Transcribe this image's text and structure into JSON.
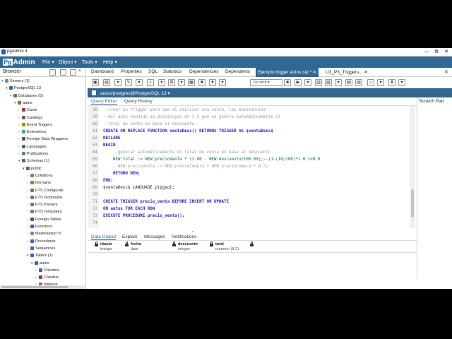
{
  "window": {
    "title": "pgAdmin 4",
    "controls": [
      "—",
      "⧉",
      "✕"
    ]
  },
  "menubar": {
    "logo_pg": "Pg",
    "logo_text": "Admin",
    "items": [
      "File",
      "Object",
      "Tools",
      "Help"
    ]
  },
  "browser": {
    "title": "Browser",
    "tree": [
      {
        "label": "Servers (1)",
        "arrow": "▾",
        "color": "#6b8fb4"
      },
      {
        "label": "PostgreSQL 13",
        "arrow": "▾",
        "color": "#336791"
      },
      {
        "label": "Databases (5)",
        "arrow": "▾",
        "color": "#8a6d3b"
      },
      {
        "label": "autos",
        "arrow": "▾",
        "color": "#8a6d3b"
      },
      {
        "label": "Casts",
        "arrow": "›",
        "color": "#a33"
      },
      {
        "label": "Catalogs",
        "arrow": "›",
        "color": "#666"
      },
      {
        "label": "Event Triggers",
        "arrow": "›",
        "color": "#b58900"
      },
      {
        "label": "Extensions",
        "arrow": "›",
        "color": "#4a7"
      },
      {
        "label": "Foreign Data Wrappers",
        "arrow": "›",
        "color": "#557"
      },
      {
        "label": "Languages",
        "arrow": "›",
        "color": "#666"
      },
      {
        "label": "Publications",
        "arrow": "›",
        "color": "#58a"
      },
      {
        "label": "Schemas (1)",
        "arrow": "▾",
        "color": "#666"
      },
      {
        "label": "public",
        "arrow": "▾",
        "color": "#666"
      },
      {
        "label": "Collations",
        "arrow": "›",
        "color": "#a73"
      },
      {
        "label": "Domains",
        "arrow": "›",
        "color": "#a73"
      },
      {
        "label": "FTS Configurati",
        "arrow": "›",
        "color": "#777"
      },
      {
        "label": "FTS Dictionarie",
        "arrow": "›",
        "color": "#777"
      },
      {
        "label": "FTS Parsers",
        "arrow": "›",
        "color": "#777"
      },
      {
        "label": "FTS Templates",
        "arrow": "›",
        "color": "#777"
      },
      {
        "label": "Foreign Tables",
        "arrow": "›",
        "color": "#557"
      },
      {
        "label": "Functions",
        "arrow": "›",
        "color": "#36c"
      },
      {
        "label": "Materialized Vi",
        "arrow": "›",
        "color": "#888"
      },
      {
        "label": "Procedures",
        "arrow": "›",
        "color": "#36c"
      },
      {
        "label": "Sequences",
        "arrow": "›",
        "color": "#666"
      },
      {
        "label": "Tables (1)",
        "arrow": "▾",
        "color": "#2b6cb0"
      },
      {
        "label": "autos",
        "arrow": "▾",
        "color": "#2b6cb0"
      },
      {
        "label": "Columns",
        "arrow": "›",
        "color": "#2b6cb0"
      },
      {
        "label": "Constrai",
        "arrow": "›",
        "color": "#a33"
      },
      {
        "label": "Indexes",
        "arrow": "›",
        "color": "#777"
      }
    ]
  },
  "tabs": {
    "items": [
      "Dashboard",
      "Properties",
      "SQL",
      "Statistics",
      "Dependencies",
      "Dependents"
    ],
    "active": "Ejemplo trigger autos.sql *",
    "extra": "U3_P3_Triggers..."
  },
  "toolbar": {
    "limit": "No limit"
  },
  "connection": "autos/postgres@PostgreSQL 13",
  "editor_tabs": [
    "Query Editor",
    "Query History"
  ],
  "scratch": "Scratch Pad",
  "editor": {
    "lines": [
      {
        "n": "58",
        "t": "--crear un trigger para que al realizar una venta, las existencias",
        "c": "cm"
      },
      {
        "n": "59",
        "t": "--del auto vendido se disminuyan en 1 y que se genere automáticamente el",
        "c": "cm"
      },
      {
        "n": "60",
        "t": "--total de venta en base al descuento.",
        "c": "cm"
      },
      {
        "n": "61",
        "t": "CREATE OR REPLACE FUNCTION ventaDesc() RETURNS TRIGGER AS $ventaDesc$",
        "c": "kw"
      },
      {
        "n": "62",
        "t": "DECLARE",
        "c": "kw"
      },
      {
        "n": "63",
        "t": "BEGIN",
        "c": "kw"
      },
      {
        "n": "64",
        "t": "    --generar automáticamente el total de venta en base al descuento.",
        "c": "cm"
      },
      {
        "n": "65",
        "t": "    NEW.total := NEW.precioVenta * (1.00 - NEW.descuento/100.00);--(1-(10/100)*1-0.1=0.9",
        "c": "nm"
      },
      {
        "n": "66",
        "t": "    --NEW.precioVenta := NEW.precioCompra + NEW.precioCompra * 0.3;",
        "c": "cm"
      },
      {
        "n": "67",
        "t": "    RETURN NEW;",
        "c": "kw"
      },
      {
        "n": "68",
        "t": "END;",
        "c": "kw"
      },
      {
        "n": "69",
        "t": "$ventaDesc$ LANGUAGE plpgsql;",
        "c": ""
      },
      {
        "n": "70",
        "t": "",
        "c": ""
      },
      {
        "n": "71",
        "t": "CREATE TRIGGER precio_venta BEFORE INSERT OR UPDATE",
        "c": "kw"
      },
      {
        "n": "72",
        "t": "ON autos FOR EACH ROW",
        "c": "kw"
      },
      {
        "n": "73",
        "t": "EXECUTE PROCEDURE precio_venta();",
        "c": "kw"
      },
      {
        "n": "74",
        "t": "",
        "c": ""
      }
    ]
  },
  "output_tabs": [
    "Data Output",
    "Explain",
    "Messages",
    "Notifications"
  ],
  "columns": [
    {
      "name": "idauto",
      "type": "integer"
    },
    {
      "name": "fecha",
      "type": "date"
    },
    {
      "name": "descuento",
      "type": "integer"
    },
    {
      "name": "total",
      "type": "numeric (8,2)"
    }
  ],
  "colors": {
    "accent": "#316893"
  }
}
